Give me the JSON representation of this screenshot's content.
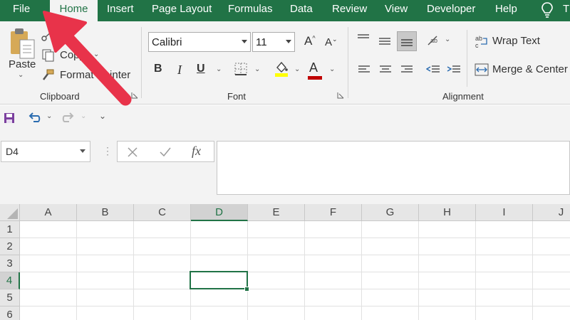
{
  "ribbon_tabs": {
    "file": "File",
    "home": "Home",
    "insert": "Insert",
    "page_layout": "Page Layout",
    "formulas": "Formulas",
    "data": "Data",
    "review": "Review",
    "view": "View",
    "developer": "Developer",
    "help": "Help",
    "tell_me_truncated": "T",
    "active": "Home",
    "tell_me_icon": "lightbulb-icon"
  },
  "clipboard_group": {
    "paste_label": "Paste",
    "cut_label": "t",
    "copy_label": "Copy",
    "format_painter_label": "Format Painter",
    "group_label": "Clipboard"
  },
  "font_group": {
    "font_name": "Calibri",
    "font_size": "11",
    "bold": "B",
    "italic": "I",
    "underline": "U",
    "grow_font": "A",
    "shrink_font": "A",
    "font_color_letter": "A",
    "group_label": "Font"
  },
  "alignment_group": {
    "wrap_text_label": "Wrap Text",
    "merge_center_label": "Merge & Center",
    "group_label": "Alignment"
  },
  "formula_bar": {
    "name_box": "D4",
    "formula_value": "",
    "cancel_icon": "close-icon",
    "enter_icon": "check-icon",
    "fx_label": "fx"
  },
  "grid": {
    "columns": [
      "A",
      "B",
      "C",
      "D",
      "E",
      "F",
      "G",
      "H",
      "I",
      "J"
    ],
    "rows": [
      "1",
      "2",
      "3",
      "4",
      "5",
      "6"
    ],
    "selected_column": "D",
    "selected_row": "4"
  },
  "colors": {
    "excel_green": "#217346",
    "annotation_red": "#e8334a",
    "font_color": "#c00000",
    "highlight": "#ffff00"
  }
}
